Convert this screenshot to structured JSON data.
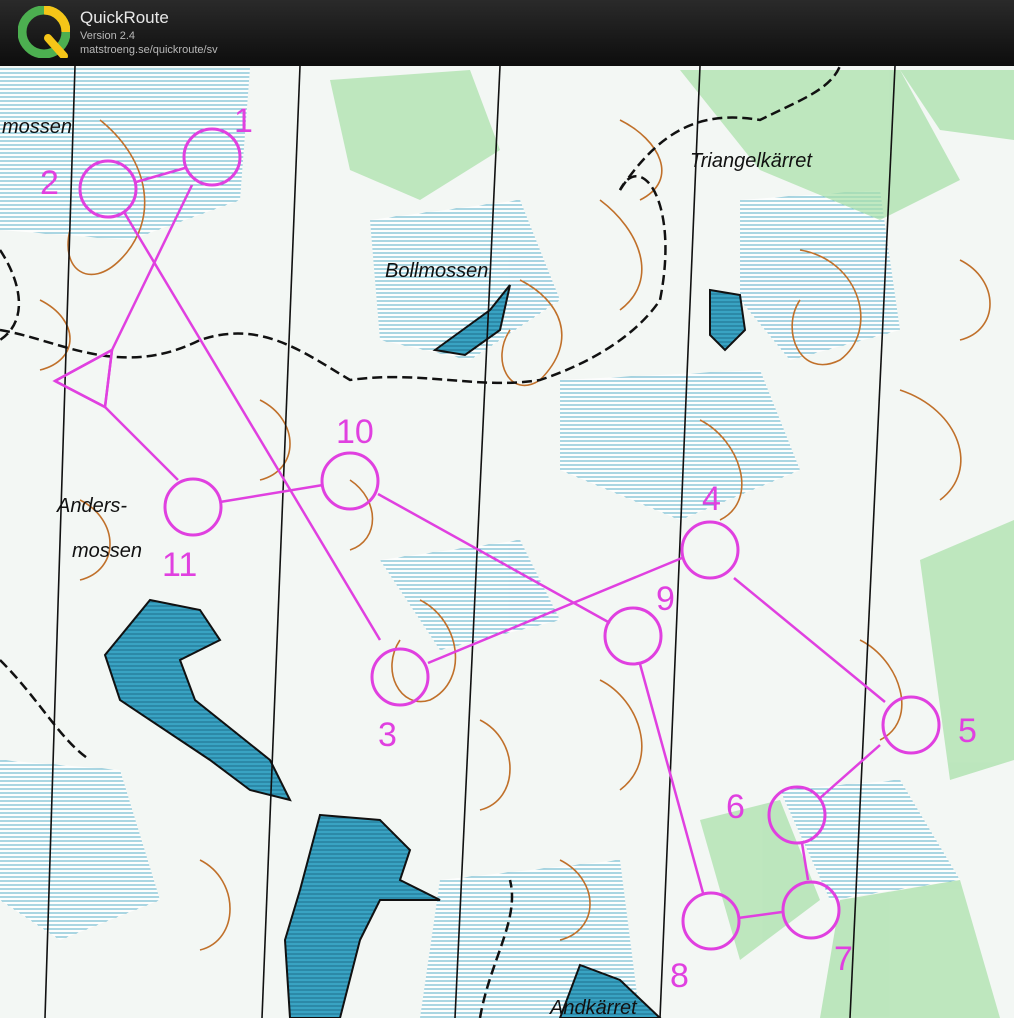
{
  "app": {
    "title": "QuickRoute",
    "version": "Version 2.4",
    "url": "matstroeng.se/quickroute/sv",
    "logo_letter": "Q"
  },
  "map": {
    "place_names": [
      "mossen",
      "Triangelkärret",
      "Bollmossen",
      "Anders-",
      "mossen",
      "Andkärret"
    ],
    "start_symbol": "triangle",
    "controls": [
      "1",
      "2",
      "3",
      "4",
      "5",
      "6",
      "7",
      "8",
      "9",
      "10",
      "11"
    ],
    "course_color": "#e040e0",
    "water_color": "#2f8fa8",
    "contour_color": "#c0702a",
    "vegetation_color": "#8fd88f"
  }
}
